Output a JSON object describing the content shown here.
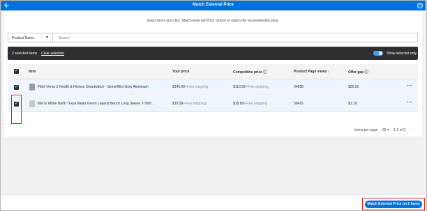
{
  "header": {
    "title": "Match External Price",
    "info_glyph": "i"
  },
  "instruction": "Select items and click \"Match External Price\" button to match the recommended price.",
  "filter": {
    "select_value": "Product Name",
    "search_placeholder": "Search"
  },
  "selection_bar": {
    "count_text": "2 selected items",
    "clear_label": "Clear selection",
    "toggle_label": "Show selected only",
    "toggle_on": true
  },
  "table": {
    "columns": [
      "Item",
      "Your price",
      "Competitive price",
      "Product Page views",
      "Offer gap"
    ],
    "rows": [
      {
        "checked": true,
        "item": "Fitbit Versa 2 Health & Fitness Smartwatch - Stone/Mist Gray Aluminum",
        "your_price": "$140.00",
        "your_shipping": "+Free shipping",
        "competitive_price": "$113.99",
        "competitive_shipping": "+Free shipping",
        "views": "34688",
        "offer_gap": "$26.01"
      },
      {
        "checked": true,
        "item": "Men's White North Texas Mean Green Legend Bench Long Sleeve T-Shirt ...",
        "your_price": "$19.99",
        "your_shipping": "+Free shipping",
        "competitive_price": "$18.89",
        "competitive_shipping": "+Free shipping",
        "views": "30416",
        "offer_gap": "$1.10"
      }
    ]
  },
  "pagination": {
    "items_per_page_label": "Items per page",
    "items_per_page_value": "25",
    "range": "1-2 of 2"
  },
  "footer": {
    "cta_label": "Match External Price on 2 items"
  },
  "colors": {
    "brand_blue": "#0071dc",
    "dark_bar": "#2e2f32",
    "highlight_red": "#e0201b",
    "selected_row": "#eef5fd"
  }
}
